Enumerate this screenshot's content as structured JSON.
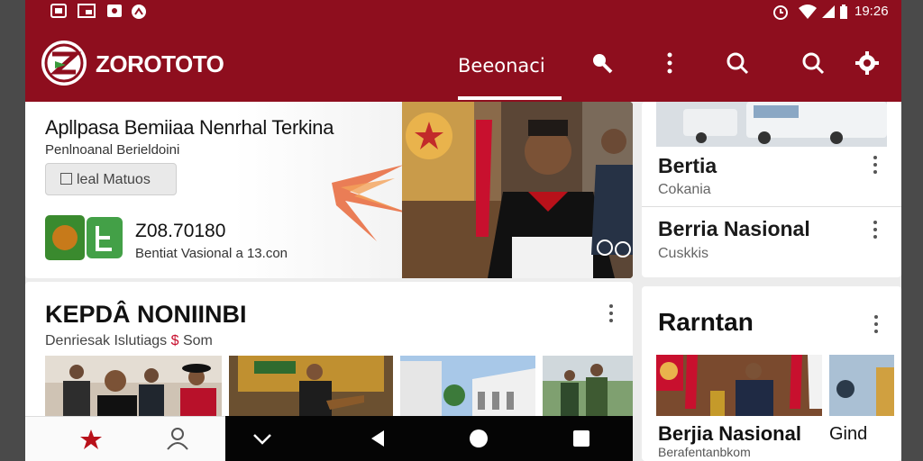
{
  "status_bar": {
    "time": "19:26",
    "left_icons": [
      "photo-icon",
      "screen-icon",
      "image-icon",
      "notification-icon"
    ],
    "right_icons": [
      "alarm-icon",
      "wifi-icon",
      "signal-icon",
      "battery-icon"
    ]
  },
  "app_bar": {
    "title": "ZOROTOTO",
    "tab": "Beeonaci",
    "actions": [
      "key-search-icon",
      "more-vert-icon",
      "search-icon",
      "search-alt-icon",
      "settings-icon"
    ]
  },
  "hero": {
    "title": "Apllpasa Bemiiaa Nenrhal Terkina",
    "subtitle": "Penlnoanal Berieldoini",
    "button": "leal Matuos",
    "promo_value": "Z08.70180",
    "promo_caption": "Bentiat Vasional a 13.con"
  },
  "side_list": {
    "items": [
      {
        "title": "Bertia",
        "subtitle": "Cokania"
      },
      {
        "title": "Berria Nasional",
        "subtitle": "Cuskkis"
      }
    ]
  },
  "section": {
    "title": "KEPDÂ NONIINBI",
    "subtitle_before": "Denriesak Islutiags",
    "subtitle_accent": "$",
    "subtitle_after": "Som"
  },
  "right_card": {
    "title": "Rarntan",
    "caption_a": "Berjia Nasional",
    "caption_b": "Gind",
    "subtitle": "Berafentanbkom"
  },
  "bottom_nav": {
    "items": [
      "home-icon",
      "profile-icon"
    ]
  },
  "system_nav": {
    "items": [
      "chevron-down-icon",
      "back-icon",
      "home-circle-icon",
      "recents-icon"
    ]
  },
  "colors": {
    "brand": "#8e0e1e",
    "accent_green": "#3a9a3c",
    "text_dark": "#111111"
  }
}
